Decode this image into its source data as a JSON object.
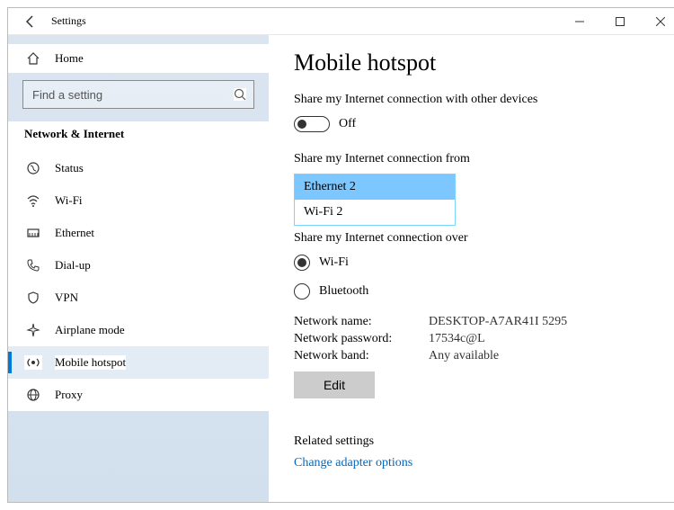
{
  "window": {
    "title": "Settings"
  },
  "sidebar": {
    "home": "Home",
    "search_placeholder": "Find a setting",
    "section": "Network & Internet",
    "items": [
      {
        "label": "Status"
      },
      {
        "label": "Wi-Fi"
      },
      {
        "label": "Ethernet"
      },
      {
        "label": "Dial-up"
      },
      {
        "label": "VPN"
      },
      {
        "label": "Airplane mode"
      },
      {
        "label": "Mobile hotspot"
      },
      {
        "label": "Proxy"
      }
    ]
  },
  "page": {
    "title": "Mobile hotspot",
    "share_label": "Share my Internet connection with other devices",
    "toggle_state": "Off",
    "share_from_label": "Share my Internet connection from",
    "share_from_options": [
      "Ethernet 2",
      "Wi-Fi 2"
    ],
    "share_over_label": "Share my Internet connection over",
    "radio_wifi": "Wi-Fi",
    "radio_bt": "Bluetooth",
    "net_name_label": "Network name:",
    "net_name_value": "DESKTOP-A7AR41I 5295",
    "net_pwd_label": "Network password:",
    "net_pwd_value": "17534c@L",
    "net_band_label": "Network band:",
    "net_band_value": "Any available",
    "edit_btn": "Edit",
    "related_header": "Related settings",
    "related_link": "Change adapter options"
  }
}
